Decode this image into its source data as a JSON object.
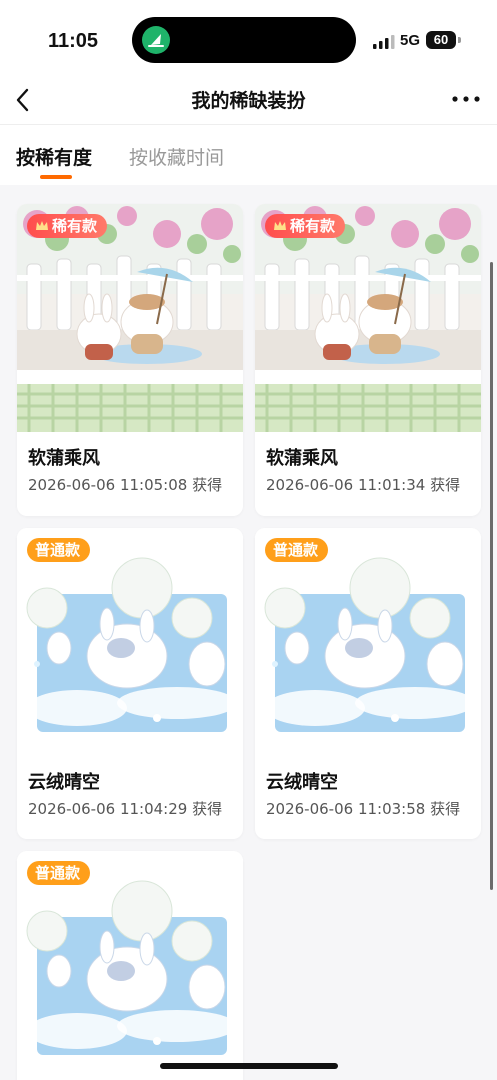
{
  "status_bar": {
    "time": "11:05",
    "network": "5G",
    "battery": "60",
    "island_app_icon": "sail-icon"
  },
  "nav": {
    "title": "我的稀缺装扮",
    "back_icon": "chevron-left-icon",
    "more_icon": "more-dots-icon"
  },
  "tabs": [
    {
      "label": "按稀有度",
      "active": true
    },
    {
      "label": "按收藏时间",
      "active": false
    }
  ],
  "accent_color": "#ff6a00",
  "items": [
    {
      "badge": "稀有款",
      "badge_type": "rare",
      "name": "软蒲乘风",
      "time": "2026-06-06 11:05:08 获得",
      "art": "garden-bunny-cat"
    },
    {
      "badge": "稀有款",
      "badge_type": "rare",
      "name": "软蒲乘风",
      "time": "2026-06-06 11:01:34 获得",
      "art": "garden-bunny-cat"
    },
    {
      "badge": "普通款",
      "badge_type": "common",
      "name": "云绒晴空",
      "time": "2026-06-06 11:04:29 获得",
      "art": "sky-dandelion-bunny"
    },
    {
      "badge": "普通款",
      "badge_type": "common",
      "name": "云绒晴空",
      "time": "2026-06-06 11:03:58 获得",
      "art": "sky-dandelion-bunny"
    },
    {
      "badge": "普通款",
      "badge_type": "common",
      "name": "",
      "time": "",
      "art": "sky-dandelion-bunny"
    }
  ]
}
